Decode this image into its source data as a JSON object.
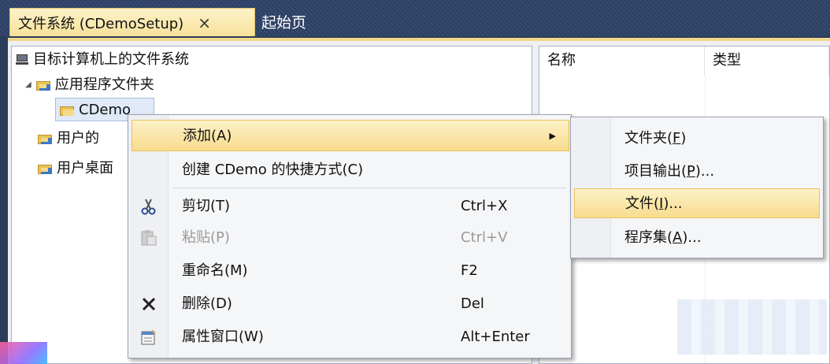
{
  "tabs": {
    "active_label": "文件系统 (CDemoSetup)",
    "close_symbol": "×",
    "inactive_label": "起始页"
  },
  "tree": {
    "root": "目标计算机上的文件系统",
    "items": [
      {
        "label": "应用程序文件夹",
        "expanded": true
      },
      {
        "label": "CDemo",
        "selected": true
      },
      {
        "label": "用户的"
      },
      {
        "label": "用户桌面"
      }
    ]
  },
  "list": {
    "columns": [
      "名称",
      "类型"
    ]
  },
  "context_menu": {
    "items": [
      {
        "label": "添加(A)",
        "has_submenu": true,
        "highlighted": true
      },
      {
        "label": "创建 CDemo 的快捷方式(C)"
      },
      {
        "label": "剪切(T)",
        "shortcut": "Ctrl+X",
        "icon": "scissors-icon"
      },
      {
        "label": "粘贴(P)",
        "shortcut": "Ctrl+V",
        "icon": "paste-icon",
        "disabled": true
      },
      {
        "label": "重命名(M)",
        "shortcut": "F2"
      },
      {
        "label": "删除(D)",
        "shortcut": "Del",
        "icon": "delete-icon"
      },
      {
        "label": "属性窗口(W)",
        "shortcut": "Alt+Enter",
        "icon": "properties-icon"
      }
    ]
  },
  "submenu": {
    "items": [
      {
        "pre": "文件夹(",
        "key": "F",
        "post": ")"
      },
      {
        "pre": "项目输出(",
        "key": "P",
        "post": ")..."
      },
      {
        "pre": "文件(",
        "key": "I",
        "post": ")...",
        "highlighted": true
      },
      {
        "pre": "程序集(",
        "key": "A",
        "post": ")..."
      }
    ]
  },
  "colors": {
    "highlight": "#f8dc8e",
    "tabstrip": "#2d3f60",
    "selection": "#dfe9f7"
  }
}
